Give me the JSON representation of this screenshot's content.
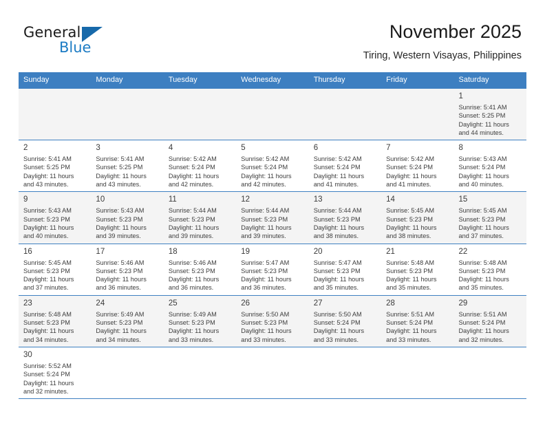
{
  "brand": {
    "name_top": "General",
    "name_bottom": "Blue",
    "accent_color": "#1769aa"
  },
  "header": {
    "title": "November 2025",
    "subtitle": "Tiring, Western Visayas, Philippines"
  },
  "calendar": {
    "header_color": "#3d7fc1",
    "weekdays": [
      "Sunday",
      "Monday",
      "Tuesday",
      "Wednesday",
      "Thursday",
      "Friday",
      "Saturday"
    ],
    "weeks": [
      [
        {
          "day": "",
          "sunrise": "",
          "sunset": "",
          "daylight1": "",
          "daylight2": ""
        },
        {
          "day": "",
          "sunrise": "",
          "sunset": "",
          "daylight1": "",
          "daylight2": ""
        },
        {
          "day": "",
          "sunrise": "",
          "sunset": "",
          "daylight1": "",
          "daylight2": ""
        },
        {
          "day": "",
          "sunrise": "",
          "sunset": "",
          "daylight1": "",
          "daylight2": ""
        },
        {
          "day": "",
          "sunrise": "",
          "sunset": "",
          "daylight1": "",
          "daylight2": ""
        },
        {
          "day": "",
          "sunrise": "",
          "sunset": "",
          "daylight1": "",
          "daylight2": ""
        },
        {
          "day": "1",
          "sunrise": "Sunrise: 5:41 AM",
          "sunset": "Sunset: 5:25 PM",
          "daylight1": "Daylight: 11 hours",
          "daylight2": "and 44 minutes."
        }
      ],
      [
        {
          "day": "2",
          "sunrise": "Sunrise: 5:41 AM",
          "sunset": "Sunset: 5:25 PM",
          "daylight1": "Daylight: 11 hours",
          "daylight2": "and 43 minutes."
        },
        {
          "day": "3",
          "sunrise": "Sunrise: 5:41 AM",
          "sunset": "Sunset: 5:25 PM",
          "daylight1": "Daylight: 11 hours",
          "daylight2": "and 43 minutes."
        },
        {
          "day": "4",
          "sunrise": "Sunrise: 5:42 AM",
          "sunset": "Sunset: 5:24 PM",
          "daylight1": "Daylight: 11 hours",
          "daylight2": "and 42 minutes."
        },
        {
          "day": "5",
          "sunrise": "Sunrise: 5:42 AM",
          "sunset": "Sunset: 5:24 PM",
          "daylight1": "Daylight: 11 hours",
          "daylight2": "and 42 minutes."
        },
        {
          "day": "6",
          "sunrise": "Sunrise: 5:42 AM",
          "sunset": "Sunset: 5:24 PM",
          "daylight1": "Daylight: 11 hours",
          "daylight2": "and 41 minutes."
        },
        {
          "day": "7",
          "sunrise": "Sunrise: 5:42 AM",
          "sunset": "Sunset: 5:24 PM",
          "daylight1": "Daylight: 11 hours",
          "daylight2": "and 41 minutes."
        },
        {
          "day": "8",
          "sunrise": "Sunrise: 5:43 AM",
          "sunset": "Sunset: 5:24 PM",
          "daylight1": "Daylight: 11 hours",
          "daylight2": "and 40 minutes."
        }
      ],
      [
        {
          "day": "9",
          "sunrise": "Sunrise: 5:43 AM",
          "sunset": "Sunset: 5:23 PM",
          "daylight1": "Daylight: 11 hours",
          "daylight2": "and 40 minutes."
        },
        {
          "day": "10",
          "sunrise": "Sunrise: 5:43 AM",
          "sunset": "Sunset: 5:23 PM",
          "daylight1": "Daylight: 11 hours",
          "daylight2": "and 39 minutes."
        },
        {
          "day": "11",
          "sunrise": "Sunrise: 5:44 AM",
          "sunset": "Sunset: 5:23 PM",
          "daylight1": "Daylight: 11 hours",
          "daylight2": "and 39 minutes."
        },
        {
          "day": "12",
          "sunrise": "Sunrise: 5:44 AM",
          "sunset": "Sunset: 5:23 PM",
          "daylight1": "Daylight: 11 hours",
          "daylight2": "and 39 minutes."
        },
        {
          "day": "13",
          "sunrise": "Sunrise: 5:44 AM",
          "sunset": "Sunset: 5:23 PM",
          "daylight1": "Daylight: 11 hours",
          "daylight2": "and 38 minutes."
        },
        {
          "day": "14",
          "sunrise": "Sunrise: 5:45 AM",
          "sunset": "Sunset: 5:23 PM",
          "daylight1": "Daylight: 11 hours",
          "daylight2": "and 38 minutes."
        },
        {
          "day": "15",
          "sunrise": "Sunrise: 5:45 AM",
          "sunset": "Sunset: 5:23 PM",
          "daylight1": "Daylight: 11 hours",
          "daylight2": "and 37 minutes."
        }
      ],
      [
        {
          "day": "16",
          "sunrise": "Sunrise: 5:45 AM",
          "sunset": "Sunset: 5:23 PM",
          "daylight1": "Daylight: 11 hours",
          "daylight2": "and 37 minutes."
        },
        {
          "day": "17",
          "sunrise": "Sunrise: 5:46 AM",
          "sunset": "Sunset: 5:23 PM",
          "daylight1": "Daylight: 11 hours",
          "daylight2": "and 36 minutes."
        },
        {
          "day": "18",
          "sunrise": "Sunrise: 5:46 AM",
          "sunset": "Sunset: 5:23 PM",
          "daylight1": "Daylight: 11 hours",
          "daylight2": "and 36 minutes."
        },
        {
          "day": "19",
          "sunrise": "Sunrise: 5:47 AM",
          "sunset": "Sunset: 5:23 PM",
          "daylight1": "Daylight: 11 hours",
          "daylight2": "and 36 minutes."
        },
        {
          "day": "20",
          "sunrise": "Sunrise: 5:47 AM",
          "sunset": "Sunset: 5:23 PM",
          "daylight1": "Daylight: 11 hours",
          "daylight2": "and 35 minutes."
        },
        {
          "day": "21",
          "sunrise": "Sunrise: 5:48 AM",
          "sunset": "Sunset: 5:23 PM",
          "daylight1": "Daylight: 11 hours",
          "daylight2": "and 35 minutes."
        },
        {
          "day": "22",
          "sunrise": "Sunrise: 5:48 AM",
          "sunset": "Sunset: 5:23 PM",
          "daylight1": "Daylight: 11 hours",
          "daylight2": "and 35 minutes."
        }
      ],
      [
        {
          "day": "23",
          "sunrise": "Sunrise: 5:48 AM",
          "sunset": "Sunset: 5:23 PM",
          "daylight1": "Daylight: 11 hours",
          "daylight2": "and 34 minutes."
        },
        {
          "day": "24",
          "sunrise": "Sunrise: 5:49 AM",
          "sunset": "Sunset: 5:23 PM",
          "daylight1": "Daylight: 11 hours",
          "daylight2": "and 34 minutes."
        },
        {
          "day": "25",
          "sunrise": "Sunrise: 5:49 AM",
          "sunset": "Sunset: 5:23 PM",
          "daylight1": "Daylight: 11 hours",
          "daylight2": "and 33 minutes."
        },
        {
          "day": "26",
          "sunrise": "Sunrise: 5:50 AM",
          "sunset": "Sunset: 5:23 PM",
          "daylight1": "Daylight: 11 hours",
          "daylight2": "and 33 minutes."
        },
        {
          "day": "27",
          "sunrise": "Sunrise: 5:50 AM",
          "sunset": "Sunset: 5:24 PM",
          "daylight1": "Daylight: 11 hours",
          "daylight2": "and 33 minutes."
        },
        {
          "day": "28",
          "sunrise": "Sunrise: 5:51 AM",
          "sunset": "Sunset: 5:24 PM",
          "daylight1": "Daylight: 11 hours",
          "daylight2": "and 33 minutes."
        },
        {
          "day": "29",
          "sunrise": "Sunrise: 5:51 AM",
          "sunset": "Sunset: 5:24 PM",
          "daylight1": "Daylight: 11 hours",
          "daylight2": "and 32 minutes."
        }
      ],
      [
        {
          "day": "30",
          "sunrise": "Sunrise: 5:52 AM",
          "sunset": "Sunset: 5:24 PM",
          "daylight1": "Daylight: 11 hours",
          "daylight2": "and 32 minutes."
        },
        {
          "day": "",
          "sunrise": "",
          "sunset": "",
          "daylight1": "",
          "daylight2": ""
        },
        {
          "day": "",
          "sunrise": "",
          "sunset": "",
          "daylight1": "",
          "daylight2": ""
        },
        {
          "day": "",
          "sunrise": "",
          "sunset": "",
          "daylight1": "",
          "daylight2": ""
        },
        {
          "day": "",
          "sunrise": "",
          "sunset": "",
          "daylight1": "",
          "daylight2": ""
        },
        {
          "day": "",
          "sunrise": "",
          "sunset": "",
          "daylight1": "",
          "daylight2": ""
        },
        {
          "day": "",
          "sunrise": "",
          "sunset": "",
          "daylight1": "",
          "daylight2": ""
        }
      ]
    ]
  }
}
